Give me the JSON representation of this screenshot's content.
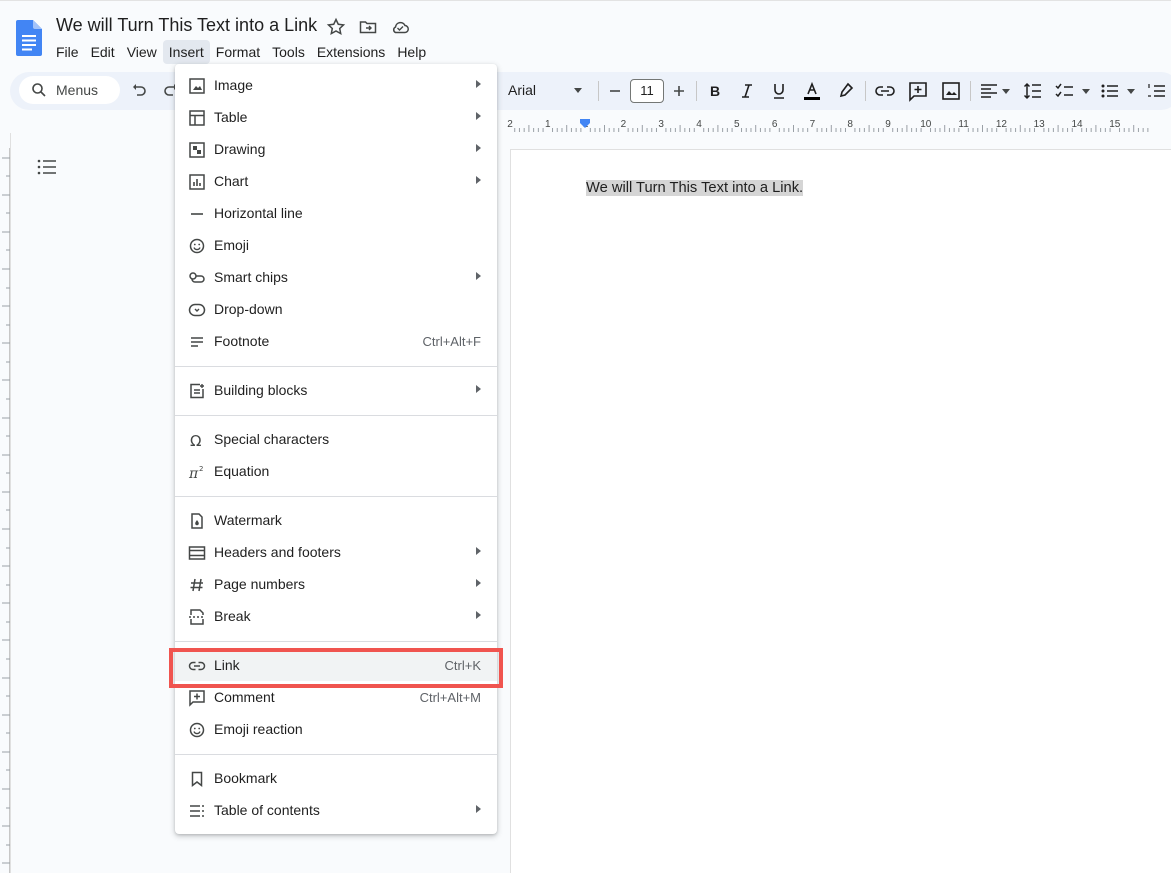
{
  "doc": {
    "title": "We will Turn This Text into a Link"
  },
  "menubar": [
    "File",
    "Edit",
    "View",
    "Insert",
    "Format",
    "Tools",
    "Extensions",
    "Help"
  ],
  "toolbar": {
    "search_label": "Menus",
    "font": "Arial",
    "font_size": "11"
  },
  "page": {
    "body_text": "We will Turn This Text into a Link."
  },
  "ruler": {
    "labels": [
      "2",
      "1",
      "1",
      "2",
      "3",
      "4",
      "5",
      "6",
      "7",
      "8",
      "9",
      "10",
      "11",
      "12",
      "13",
      "14",
      "15"
    ]
  },
  "insert_menu": {
    "items": [
      {
        "label": "Image",
        "icon": "image-icon",
        "submenu": true
      },
      {
        "label": "Table",
        "icon": "table-icon",
        "submenu": true
      },
      {
        "label": "Drawing",
        "icon": "drawing-icon",
        "submenu": true
      },
      {
        "label": "Chart",
        "icon": "chart-icon",
        "submenu": true
      },
      {
        "label": "Horizontal line",
        "icon": "horizontal-line-icon"
      },
      {
        "label": "Emoji",
        "icon": "emoji-icon"
      },
      {
        "label": "Smart chips",
        "icon": "smart-chips-icon",
        "submenu": true
      },
      {
        "label": "Drop-down",
        "icon": "dropdown-icon"
      },
      {
        "label": "Footnote",
        "icon": "footnote-icon",
        "shortcut": "Ctrl+Alt+F"
      },
      {
        "label": "Building blocks",
        "icon": "building-blocks-icon",
        "submenu": true
      },
      {
        "label": "Special characters",
        "icon": "omega-icon"
      },
      {
        "label": "Equation",
        "icon": "pi-icon"
      },
      {
        "label": "Watermark",
        "icon": "watermark-icon"
      },
      {
        "label": "Headers and footers",
        "icon": "headers-footers-icon",
        "submenu": true
      },
      {
        "label": "Page numbers",
        "icon": "hash-icon",
        "submenu": true
      },
      {
        "label": "Break",
        "icon": "break-icon",
        "submenu": true
      },
      {
        "label": "Link",
        "icon": "link-icon",
        "shortcut": "Ctrl+K",
        "highlighted": true
      },
      {
        "label": "Comment",
        "icon": "comment-icon",
        "shortcut": "Ctrl+Alt+M"
      },
      {
        "label": "Emoji reaction",
        "icon": "emoji-reaction-icon"
      },
      {
        "label": "Bookmark",
        "icon": "bookmark-icon"
      },
      {
        "label": "Table of contents",
        "icon": "toc-icon",
        "submenu": true
      }
    ]
  },
  "colors": {
    "highlight_box": "#f0544f",
    "docs_blue": "#4285f4"
  }
}
